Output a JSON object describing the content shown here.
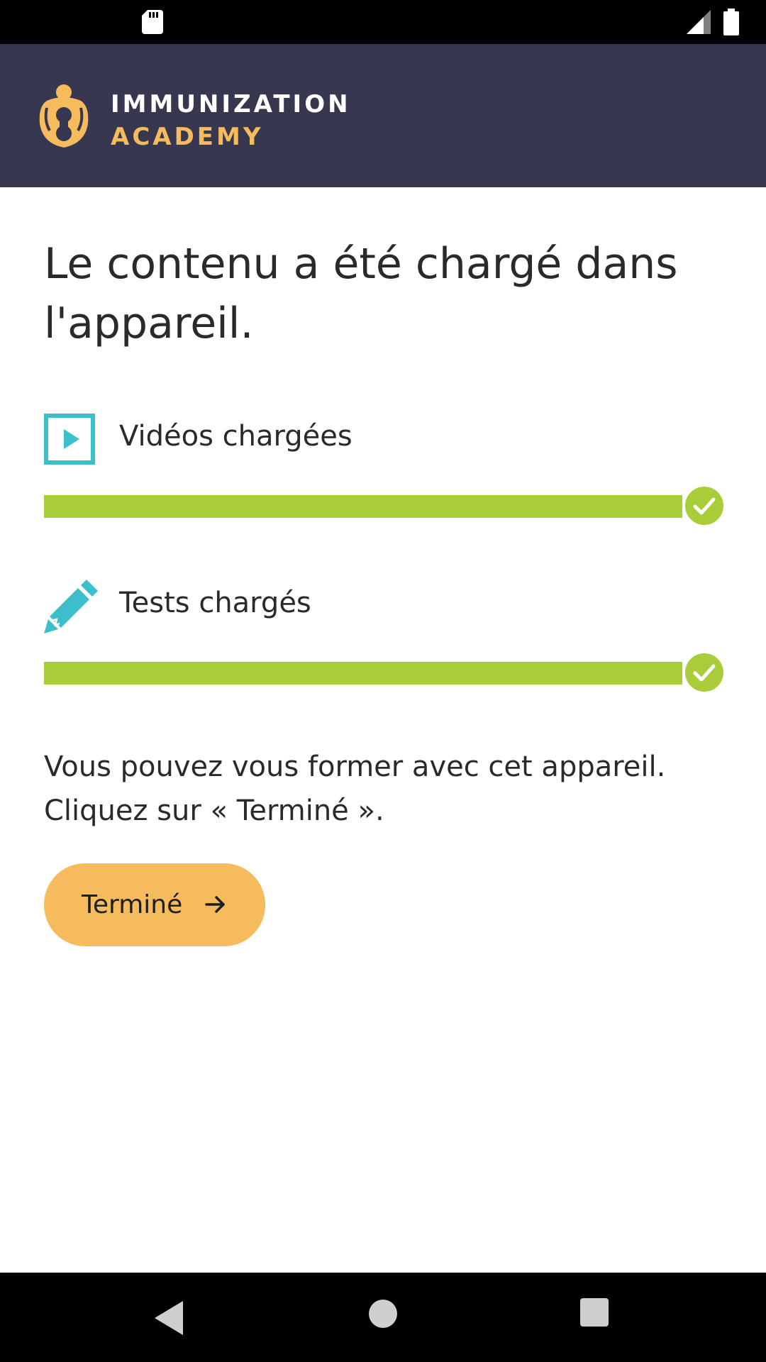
{
  "status_bar": {
    "sd_icon": "sd-card-icon",
    "signal_icon": "signal-icon",
    "battery_icon": "battery-icon"
  },
  "header": {
    "logo_icon": "immunization-academy-logo",
    "logo_line1": "IMMUNIZATION",
    "logo_line2": "ACADEMY",
    "background": "#373850",
    "accent": "#f5bb5c"
  },
  "main": {
    "title": "Le contenu a été chargé dans l'appareil.",
    "items": [
      {
        "icon": "video-play-icon",
        "label": "Vidéos chargées",
        "progress": 1.0,
        "status_icon": "check-circle-icon"
      },
      {
        "icon": "pencil-icon",
        "label": "Tests chargés",
        "progress": 1.0,
        "status_icon": "check-circle-icon"
      }
    ],
    "progress_color": "#a9cd38",
    "info_line1": "Vous pouvez vous former avec cet appareil.",
    "info_line2": "Cliquez sur « Terminé ».",
    "done_button": {
      "label": "Terminé",
      "icon": "arrow-right-icon"
    }
  },
  "nav_bar": {
    "back": "back-icon",
    "home": "home-icon",
    "recents": "recents-icon"
  }
}
